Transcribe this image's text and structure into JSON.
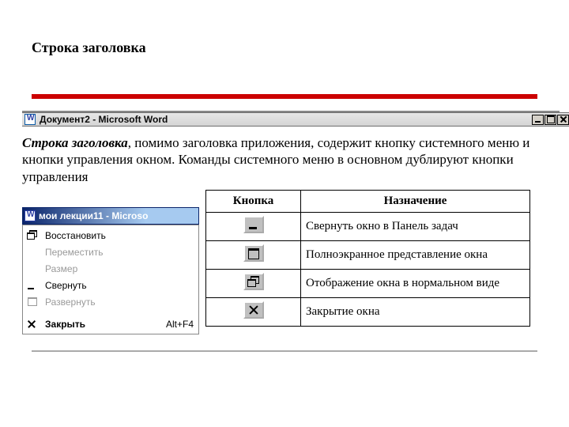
{
  "slide": {
    "title": "Строка заголовка"
  },
  "titlebar": {
    "title": "Документ2 - Microsoft Word",
    "buttons": {
      "min": "minimize",
      "max": "maximize",
      "close": "close"
    }
  },
  "paragraph": {
    "lead": "Строка заголовка",
    "rest": ", помимо заголовка приложения, содержит кнопку системного меню и кнопки управления окном. Команды системного меню в основном дублируют кнопки управления"
  },
  "table": {
    "headers": {
      "button": "Кнопка",
      "purpose": "Назначение"
    },
    "rows": [
      {
        "icon": "min",
        "desc": "Свернуть окно в Панель задач"
      },
      {
        "icon": "max",
        "desc": "Полноэкранное представление окна"
      },
      {
        "icon": "restore",
        "desc": "Отображение окна в нормальном виде"
      },
      {
        "icon": "close",
        "desc": "Закрытие окна"
      }
    ]
  },
  "sysmenu": {
    "title": "мои лекции11 - Microso",
    "items": [
      {
        "icon": "restore",
        "label": "Восстановить",
        "enabled": true,
        "shortcut": ""
      },
      {
        "icon": "",
        "label": "Переместить",
        "enabled": false,
        "shortcut": ""
      },
      {
        "icon": "",
        "label": "Размер",
        "enabled": false,
        "shortcut": ""
      },
      {
        "icon": "min",
        "label": "Свернуть",
        "enabled": true,
        "shortcut": ""
      },
      {
        "icon": "max",
        "label": "Развернуть",
        "enabled": false,
        "shortcut": ""
      },
      {
        "sep": true
      },
      {
        "icon": "close",
        "label": "Закрыть",
        "enabled": true,
        "shortcut": "Alt+F4",
        "bold": true
      }
    ]
  }
}
